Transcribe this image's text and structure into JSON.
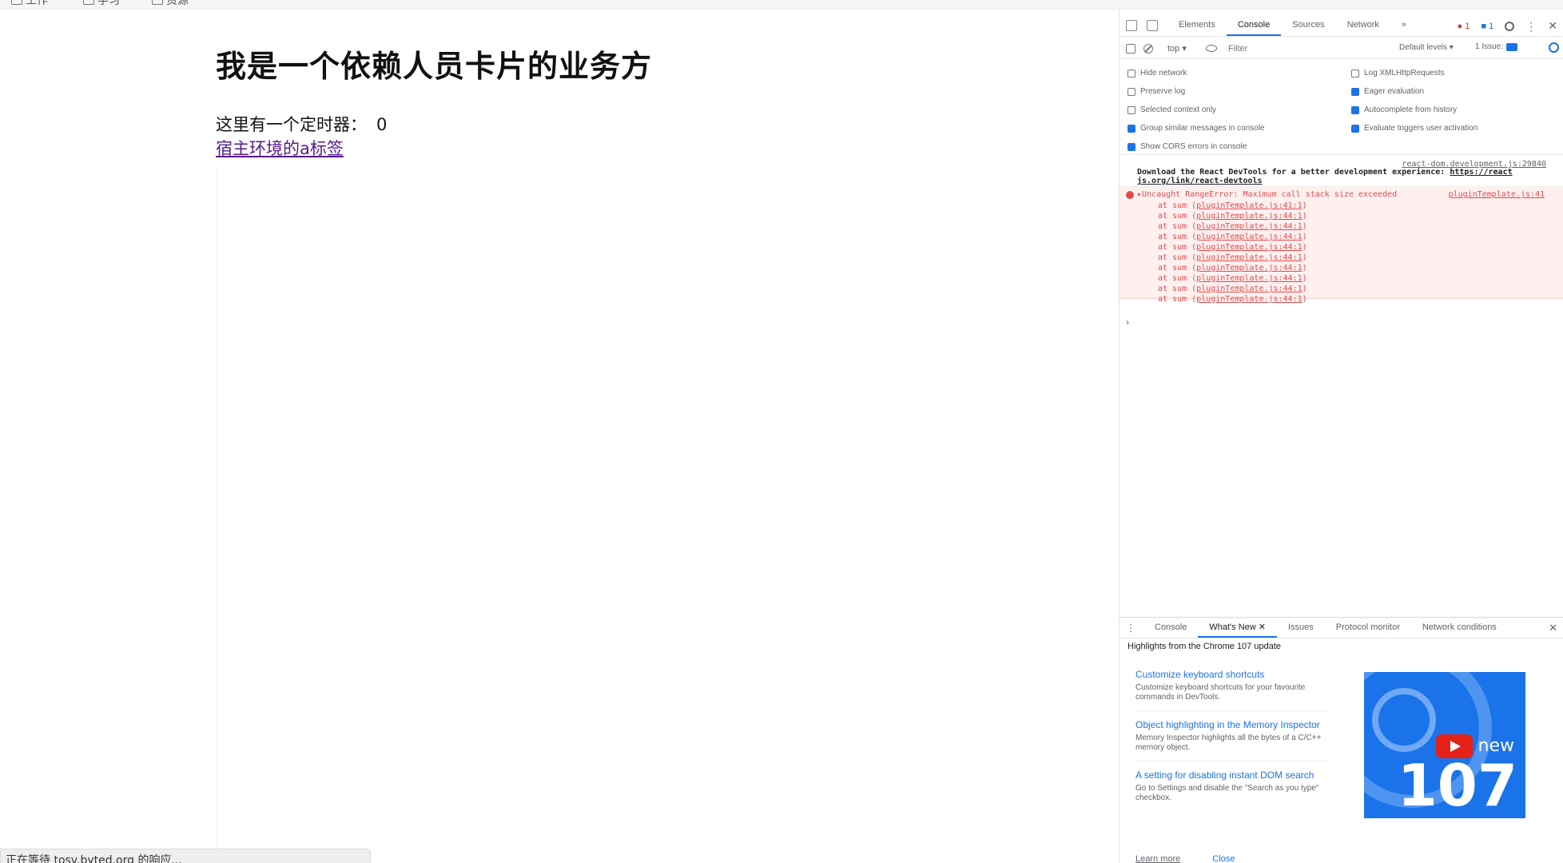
{
  "bookmarks": [
    {
      "icon": "page-icon",
      "label": "工作"
    },
    {
      "icon": "page-icon",
      "label": "学习"
    },
    {
      "icon": "page-icon",
      "label": "资源"
    }
  ],
  "page": {
    "title": "我是一个依赖人员卡片的业务方",
    "timer_label": "这里有一个定时器：",
    "timer_value": "0",
    "host_link": "宿主环境的a标签"
  },
  "status_bar": "正在等待 tosv.byted.org 的响应...",
  "devtools": {
    "tabs": [
      "Elements",
      "Console",
      "Sources",
      "Network",
      "»"
    ],
    "active_tab": "Console",
    "error_count": "1",
    "message_count": "1",
    "toolbar": {
      "context": "top ▾",
      "filter_placeholder": "Filter",
      "levels": "Default levels ▾",
      "issues": "1 Issue:"
    },
    "settings_left": [
      {
        "label": "Hide network",
        "checked": false
      },
      {
        "label": "Preserve log",
        "checked": false
      },
      {
        "label": "Selected context only",
        "checked": false
      },
      {
        "label": "Group similar messages in console",
        "checked": true
      },
      {
        "label": "Show CORS errors in console",
        "checked": true
      }
    ],
    "settings_right": [
      {
        "label": "Log XMLHttpRequests",
        "checked": false
      },
      {
        "label": "Eager evaluation",
        "checked": true
      },
      {
        "label": "Autocomplete from history",
        "checked": true
      },
      {
        "label": "Evaluate triggers user activation",
        "checked": true
      }
    ],
    "info_message": {
      "source": "react-dom.development.js:29840",
      "text": "Download the React DevTools for a better development experience: ",
      "link_a": "https://react",
      "link_b": "js.org/link/react-devtools"
    },
    "error_message": {
      "text": "▸Uncaught RangeError: Maximum call stack size exceeded",
      "source": "pluginTemplate.js:41",
      "stack": [
        {
          "fn": "at sum (",
          "loc": "pluginTemplate.js:41:1",
          "end": ")"
        },
        {
          "fn": "at sum (",
          "loc": "pluginTemplate.js:44:1",
          "end": ")"
        },
        {
          "fn": "at sum (",
          "loc": "pluginTemplate.js:44:1",
          "end": ")"
        },
        {
          "fn": "at sum (",
          "loc": "pluginTemplate.js:44:1",
          "end": ")"
        },
        {
          "fn": "at sum (",
          "loc": "pluginTemplate.js:44:1",
          "end": ")"
        },
        {
          "fn": "at sum (",
          "loc": "pluginTemplate.js:44:1",
          "end": ")"
        },
        {
          "fn": "at sum (",
          "loc": "pluginTemplate.js:44:1",
          "end": ")"
        },
        {
          "fn": "at sum (",
          "loc": "pluginTemplate.js:44:1",
          "end": ")"
        },
        {
          "fn": "at sum (",
          "loc": "pluginTemplate.js:44:1",
          "end": ")"
        },
        {
          "fn": "at sum (",
          "loc": "pluginTemplate.js:44:1",
          "end": ")"
        }
      ]
    },
    "prompt": "›",
    "drawer": {
      "tabs": [
        "Console",
        "What's New",
        "Issues",
        "Protocol monitor",
        "Network conditions"
      ],
      "active_tab": "What's New",
      "heading": "Highlights from the Chrome 107 update",
      "items": [
        {
          "title": "Customize keyboard shortcuts",
          "desc": "Customize keyboard shortcuts for your favourite commands in DevTools."
        },
        {
          "title": "Object highlighting in the Memory Inspector",
          "desc": "Memory Inspector highlights all the bytes of a C/C++ memory object."
        },
        {
          "title": "A setting for disabling instant DOM search",
          "desc": "Go to Settings and disable the \"Search as you type\" checkbox."
        }
      ],
      "promo_new": "new",
      "promo_version": "107",
      "bottom_links": [
        "Learn more",
        "Close"
      ]
    }
  }
}
